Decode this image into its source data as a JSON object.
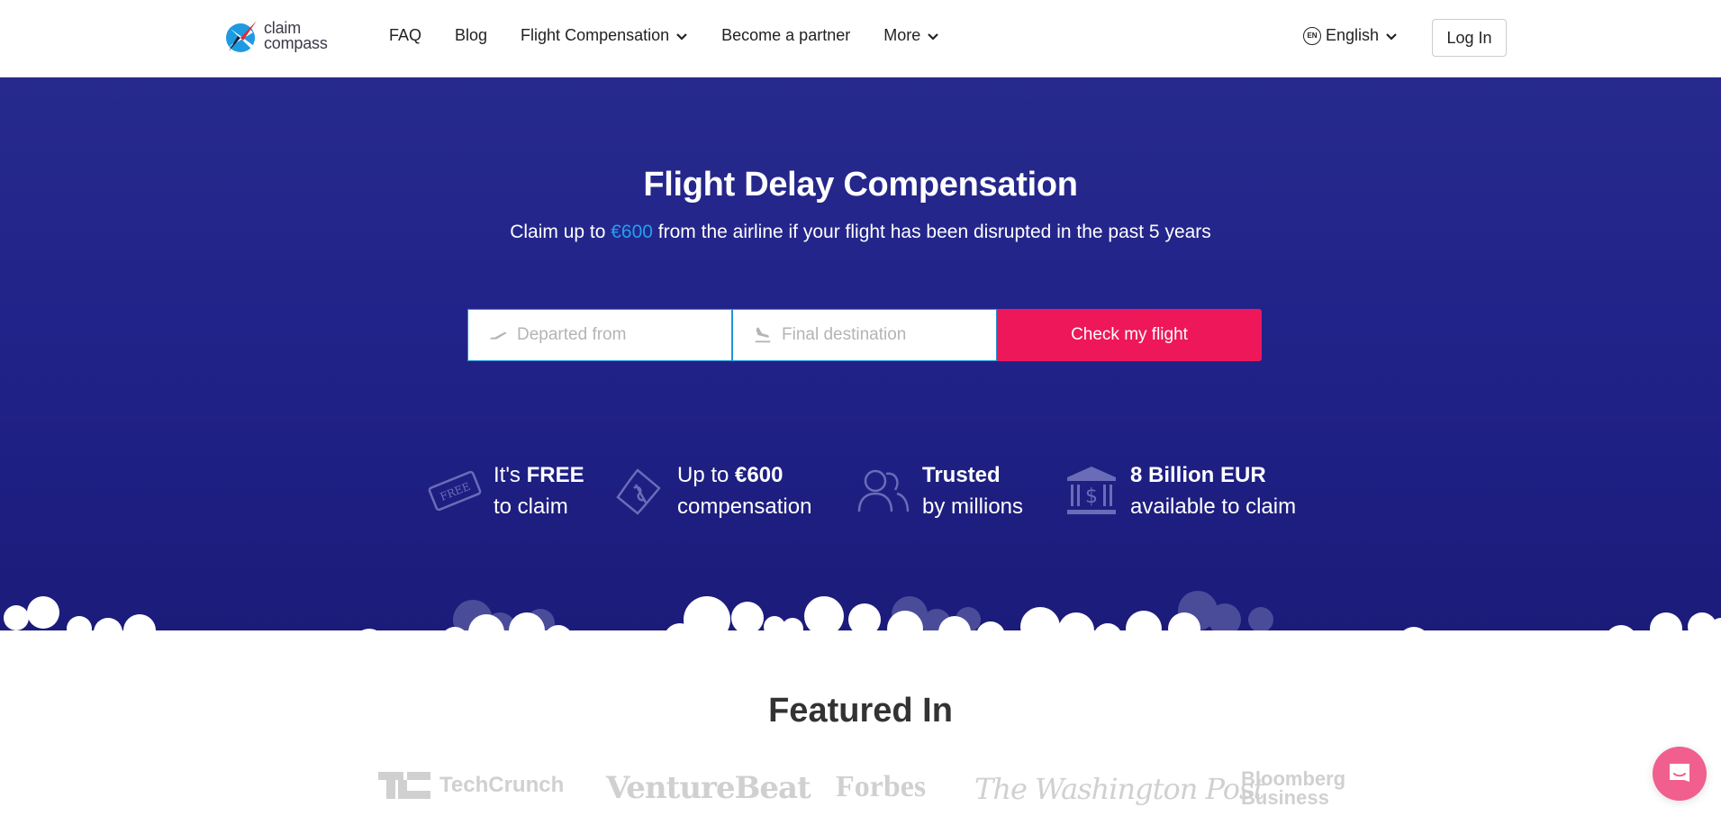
{
  "brand": {
    "line1": "claim",
    "line2": "compass"
  },
  "nav": {
    "items": [
      {
        "label": "FAQ",
        "dropdown": false
      },
      {
        "label": "Blog",
        "dropdown": false
      },
      {
        "label": "Flight Compensation",
        "dropdown": true
      },
      {
        "label": "Become a partner",
        "dropdown": false
      },
      {
        "label": "More",
        "dropdown": true
      }
    ],
    "language": {
      "code": "EN",
      "label": "English"
    },
    "login_label": "Log In"
  },
  "hero": {
    "title": "Flight Delay Compensation",
    "subtitle_pre": "Claim up to ",
    "subtitle_amount": "€600",
    "subtitle_post": " from the airline if your flight has been disrupted in the past 5 years",
    "accent_color": "#21a0f0",
    "form": {
      "departed_placeholder": "Departed from",
      "departed_value": "",
      "destination_placeholder": "Final destination",
      "destination_value": "",
      "submit_label": "Check my flight",
      "submit_color": "#ee175a"
    }
  },
  "features": [
    {
      "icon": "free-ticket-icon",
      "line1_pre": "It's ",
      "line1_bold": "FREE",
      "line2": "to claim"
    },
    {
      "icon": "money-bill-icon",
      "line1_pre": "Up to ",
      "line1_bold": "€600",
      "line2": "compensation"
    },
    {
      "icon": "users-icon",
      "line1_pre": "",
      "line1_bold": "Trusted",
      "line2": "by millions"
    },
    {
      "icon": "bank-icon",
      "line1_pre": "",
      "line1_bold": "8 Billion EUR",
      "line2": "available to claim"
    }
  ],
  "featured": {
    "title": "Featured In",
    "outlets": [
      "TechCrunch",
      "VentureBeat",
      "Forbes",
      "The Washington Post",
      "Bloomberg Business"
    ]
  },
  "chat": {
    "icon": "chat-icon"
  }
}
